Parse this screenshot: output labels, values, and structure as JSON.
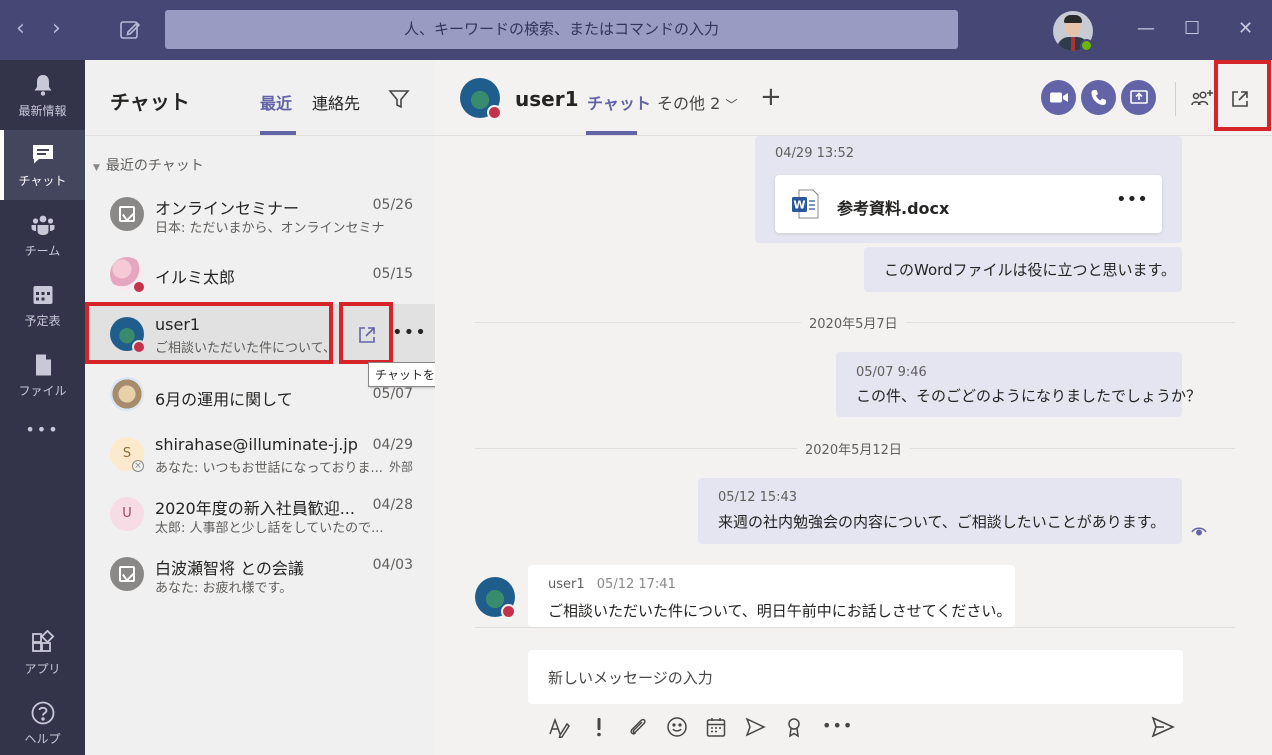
{
  "titlebar": {
    "search_placeholder": "人、キーワードの検索、またはコマンドの入力",
    "nav_back": "‹",
    "nav_forward": "›",
    "win_min": "—",
    "win_max": "☐",
    "win_close": "✕"
  },
  "rail": {
    "items": [
      {
        "label": "最新情報",
        "icon": "bell-icon"
      },
      {
        "label": "チャット",
        "icon": "chat-icon",
        "active": true
      },
      {
        "label": "チーム",
        "icon": "teams-icon"
      },
      {
        "label": "予定表",
        "icon": "calendar-icon"
      },
      {
        "label": "ファイル",
        "icon": "file-icon"
      }
    ],
    "more": "•••",
    "apps_label": "アプリ",
    "help_label": "ヘルプ"
  },
  "chatlist": {
    "title": "チャット",
    "tab_recent": "最近",
    "tab_contacts": "連絡先",
    "section": "最近のチャット",
    "items": [
      {
        "name": "オンラインセミナー",
        "preview": "日本: ただいまから、オンラインセミナー...",
        "date": "05/26"
      },
      {
        "name": "イルミ太郎",
        "preview": "",
        "date": "05/15"
      },
      {
        "name": "user1",
        "preview": "ご相談いただいた件について、...",
        "date": ""
      },
      {
        "name": "6月の運用に関して",
        "preview": "",
        "date": "05/07"
      },
      {
        "name": "shirahase@illuminate-j.jp",
        "preview": "あなた: いつもお世話になっておりま...",
        "date": "04/29",
        "extra": "外部",
        "initial": "S"
      },
      {
        "name": "2020年度の新入社員歓迎...",
        "preview": "太郎: 人事部と少し話をしていたので...",
        "date": "04/28",
        "initial": "U"
      },
      {
        "name": "白波瀬智将 との会議",
        "preview": "あなた: お疲れ様です。",
        "date": "04/03"
      }
    ],
    "more": "•••",
    "tooltip": "チャットをポップアップ表示する"
  },
  "conversation": {
    "name": "user1",
    "tab_chat": "チャット",
    "tab_more": "その他 2",
    "plus": "+",
    "messages": {
      "file_time": "04/29 13:52",
      "file_name": "参考資料.docx",
      "file_more": "•••",
      "word_msg": "このWordファイルは役に立つと思います。",
      "date1": "2020年5月7日",
      "m2_time": "05/07 9:46",
      "m2_text": "この件、そのごどのようになりましたでしょうか？",
      "date2": "2020年5月12日",
      "m3_time": "05/12 15:43",
      "m3_text": "来週の社内勉強会の内容について、ご相談したいことがあります。",
      "in_sender": "user1",
      "in_time": "05/12 17:41",
      "in_text": "ご相談いただいた件について、明日午前中にお話しさせてください。"
    },
    "compose_placeholder": "新しいメッセージの入力",
    "tool_more": "•••"
  },
  "colors": {
    "brand": "#6264a7",
    "titlebar": "#464775",
    "rail": "#33344a",
    "highlight": "#d6242b",
    "busy": "#c4314b"
  }
}
